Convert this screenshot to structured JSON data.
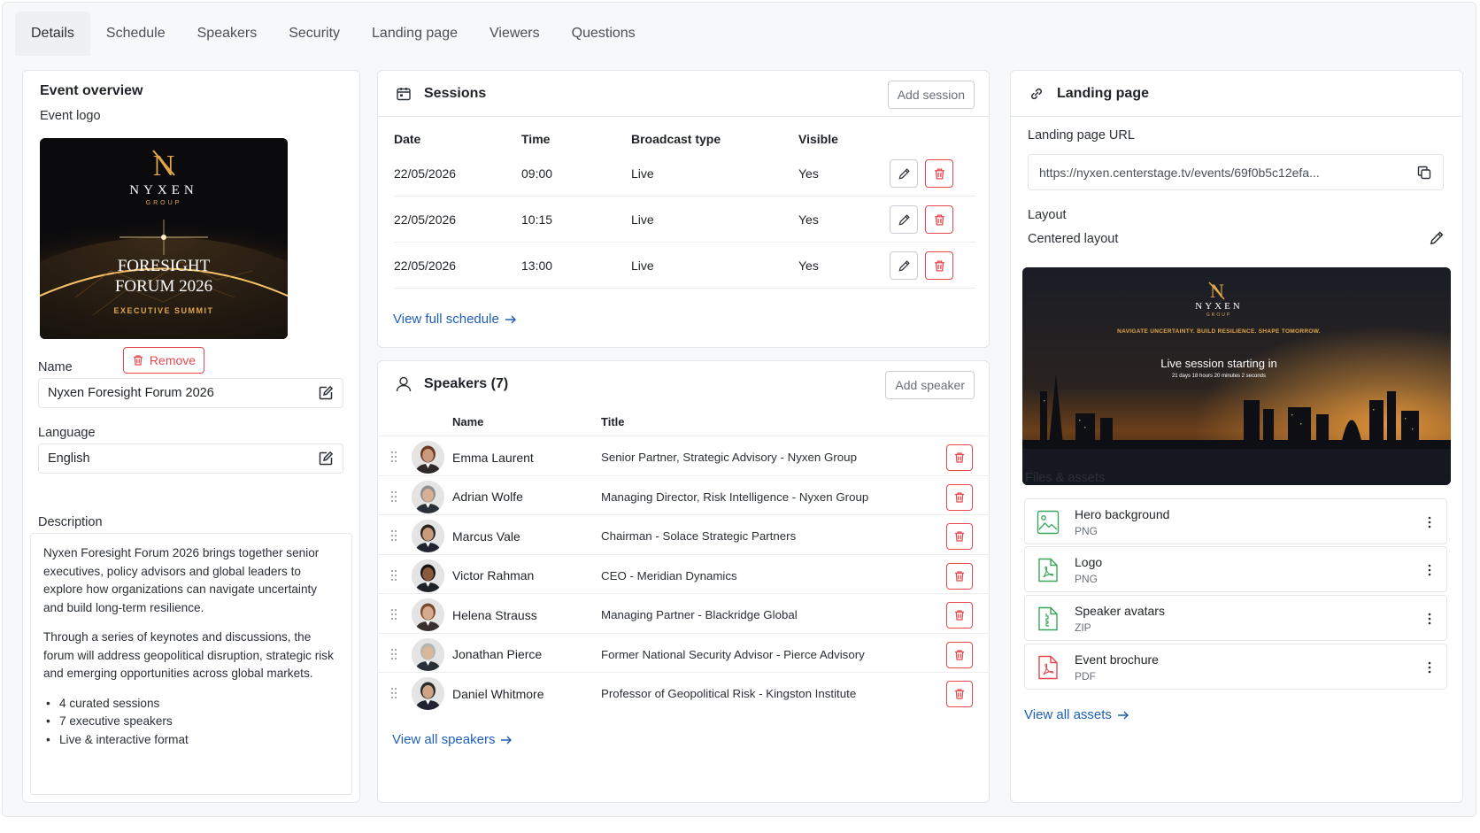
{
  "tabs": [
    {
      "label": "Details",
      "active": true
    },
    {
      "label": "Schedule"
    },
    {
      "label": "Speakers"
    },
    {
      "label": "Security"
    },
    {
      "label": "Landing page"
    },
    {
      "label": "Viewers"
    },
    {
      "label": "Questions"
    }
  ],
  "overview": {
    "title": "Event overview",
    "logo_label": "Event logo",
    "logo": {
      "brand": "NYXEN",
      "group": "GROUP",
      "headline_1": "FORESIGHT",
      "headline_2": "FORUM 2026",
      "tagline": "EXECUTIVE SUMMIT"
    },
    "remove_label": "Remove",
    "name_label": "Name",
    "name_value": "Nyxen Foresight Forum 2026",
    "language_label": "Language",
    "language_value": "English",
    "description_label": "Description",
    "description_p1": "Nyxen Foresight Forum 2026 brings together senior executives, policy advisors and global leaders to explore how organizations can navigate uncertainty and build long-term resilience.",
    "description_p2": "Through a series of keynotes and discussions, the forum will address geopolitical disruption, strategic risk and emerging opportunities across global markets.",
    "bullets": [
      "4 curated sessions",
      "7 executive speakers",
      "Live & interactive format"
    ]
  },
  "sessions": {
    "title": "Sessions",
    "add_label": "Add session",
    "columns": [
      "Date",
      "Time",
      "Broadcast type",
      "Visible"
    ],
    "rows": [
      {
        "date": "22/05/2026",
        "time": "09:00",
        "type": "Live",
        "visible": "Yes"
      },
      {
        "date": "22/05/2026",
        "time": "10:15",
        "type": "Live",
        "visible": "Yes"
      },
      {
        "date": "22/05/2026",
        "time": "13:00",
        "type": "Live",
        "visible": "Yes"
      }
    ],
    "link": "View full schedule"
  },
  "speakers": {
    "title": "Speakers (7)",
    "add_label": "Add speaker",
    "columns": [
      "Name",
      "Title"
    ],
    "rows": [
      {
        "name": "Emma Laurent",
        "title": "Senior Partner, Strategic Advisory - Nyxen Group"
      },
      {
        "name": "Adrian Wolfe",
        "title": "Managing Director, Risk Intelligence - Nyxen Group"
      },
      {
        "name": "Marcus Vale",
        "title": "Chairman - Solace Strategic Partners"
      },
      {
        "name": "Victor Rahman",
        "title": "CEO - Meridian Dynamics"
      },
      {
        "name": "Helena Strauss",
        "title": "Managing Partner - Blackridge Global"
      },
      {
        "name": "Jonathan Pierce",
        "title": "Former National Security Advisor - Pierce Advisory"
      },
      {
        "name": "Daniel Whitmore",
        "title": "Professor of Geopolitical Risk - Kingston Institute"
      }
    ],
    "link": "View all speakers"
  },
  "landing": {
    "title": "Landing page",
    "url_label": "Landing page URL",
    "url_value": "https://nyxen.centerstage.tv/events/69f0b5c12efa...",
    "layout_label": "Layout",
    "layout_value": "Centered layout",
    "preview": {
      "brand": "NYXEN",
      "group": "GROUP",
      "tagline": "NAVIGATE UNCERTAINTY. BUILD RESILIENCE. SHAPE TOMORROW.",
      "countdown_title": "Live session starting in",
      "countdown_value": "21 days 18 hours 20 minutes 2 seconds"
    },
    "files_label": "Files & assets",
    "assets": [
      {
        "name": "Hero background",
        "type": "PNG",
        "icon": "image-file-icon"
      },
      {
        "name": "Logo",
        "type": "PNG",
        "icon": "pdf-file-icon"
      },
      {
        "name": "Speaker avatars",
        "type": "ZIP",
        "icon": "zip-file-icon"
      },
      {
        "name": "Event brochure",
        "type": "PDF",
        "icon": "pdf-file-icon"
      }
    ],
    "link": "View all assets"
  },
  "colors": {
    "accent_link": "#1d5fb8",
    "danger": "#e5484d",
    "gold": "#e0a64a",
    "file_green": "#3aa55a"
  }
}
